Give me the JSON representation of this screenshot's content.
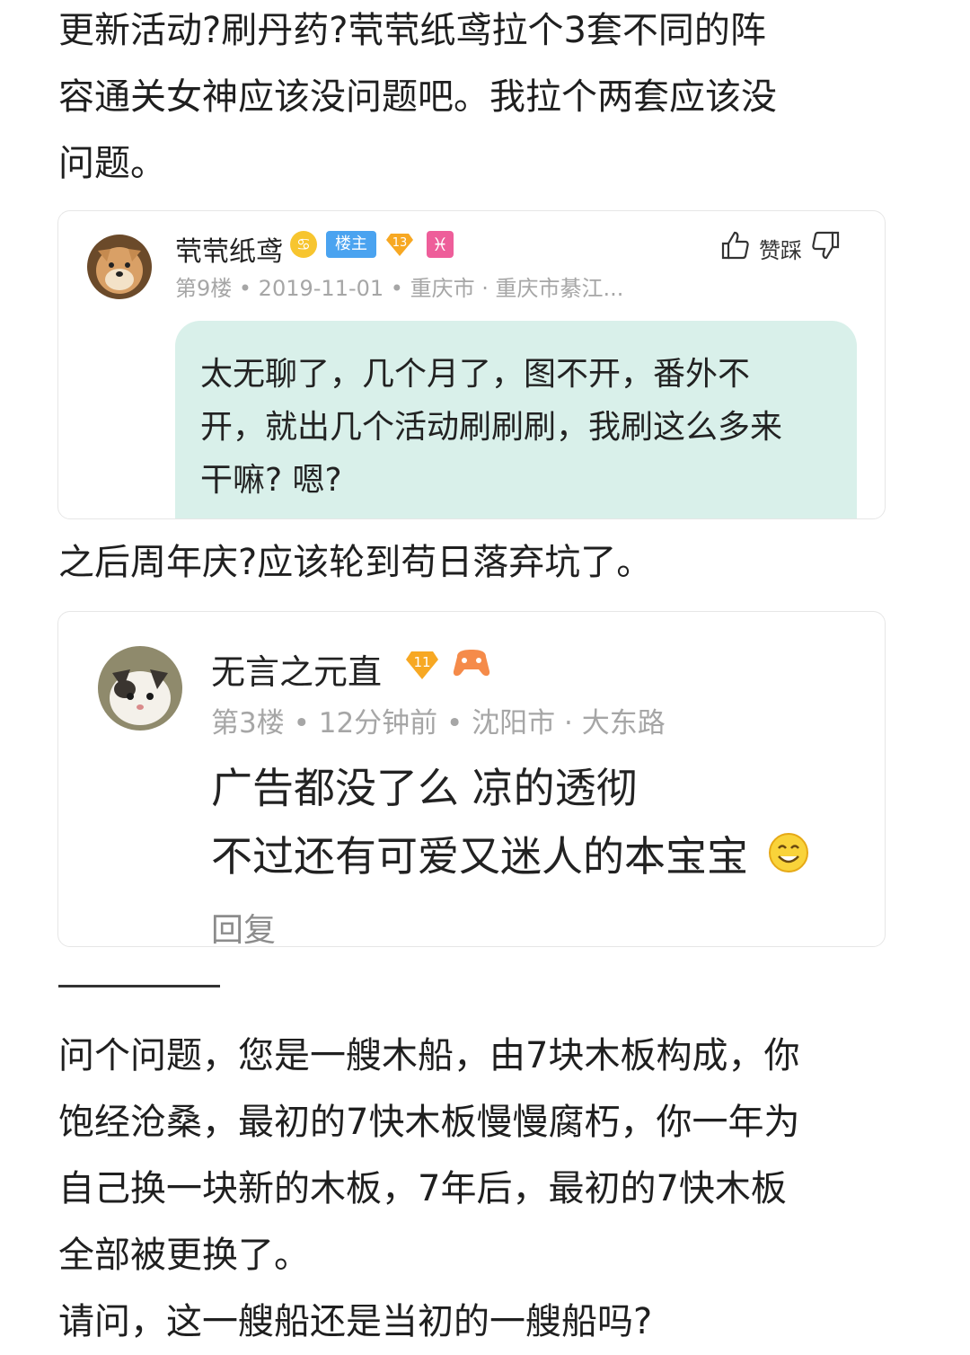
{
  "paragraphs": {
    "p1": "更新活动?刷丹药?茕茕纸鸢拉个3套不同的阵\n容通关女神应该没问题吧。我拉个两套应该没\n问题。",
    "p2": "之后周年庆?应该轮到苟日落弃坑了。",
    "separator": "————",
    "p3": "问个问题，您是一艘木船，由7块木板构成，你\n饱经沧桑，最初的7快木板慢慢腐朽，你一年为\n自己换一块新的木板，7年后，最初的7快木板\n全部被更换了。\n请问，这一艘船还是当初的一艘船吗?"
  },
  "card1": {
    "username": "茕茕纸鸢",
    "owner_badge": "楼主",
    "level": "13",
    "meta": "第9楼 • 2019-11-01 • 重庆市 · 重庆市綦江...",
    "like_label": "赞踩",
    "quote_text": "太无聊了，几个月了，图不开，番外不\n开，就出几个活动刷刷刷，我刷这么多来\n干嘛? 嗯?",
    "icons": [
      "avatar",
      "cancer-zodiac-icon",
      "level-diamond-icon",
      "pisces-zodiac-icon",
      "thumbs-up-icon",
      "thumbs-down-icon"
    ]
  },
  "card2": {
    "username": "无言之元直",
    "level": "11",
    "meta": "第3楼 • 12分钟前 • 沈阳市 · 大东路",
    "line1": "广告都没了么 凉的透彻",
    "line2": "不过还有可爱又迷人的本宝宝",
    "reply_label": "回复",
    "icons": [
      "avatar",
      "level-diamond-icon",
      "game-badge-icon",
      "smile-emoji-icon"
    ]
  },
  "colors": {
    "quote_bg": "#d9f0ea",
    "owner_badge": "#4aa3f0",
    "level_badge": "#f7a823",
    "meta_text": "#a6a6a6"
  }
}
